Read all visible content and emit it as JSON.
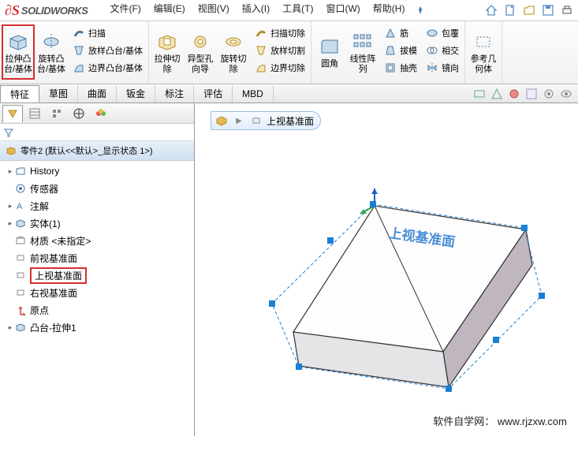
{
  "app": {
    "name": "SOLIDWORKS"
  },
  "menu": {
    "file": "文件(F)",
    "edit": "编辑(E)",
    "view": "视图(V)",
    "insert": "插入(I)",
    "tools": "工具(T)",
    "window": "窗口(W)",
    "help": "帮助(H)"
  },
  "ribbon": {
    "extrude_boss": "拉伸凸台/基体",
    "revolve_boss": "旋转凸台/基体",
    "swept": "扫描",
    "lofted": "放样凸台/基体",
    "boundary": "边界凸台/基体",
    "extrude_cut": "拉伸切除",
    "hole_wizard": "异型孔向导",
    "revolve_cut": "旋转切除",
    "swept_cut": "扫描切除",
    "lofted_cut": "放样切割",
    "boundary_cut": "边界切除",
    "fillet": "圆角",
    "linear_pattern": "线性阵列",
    "rib": "筋",
    "draft": "拔模",
    "shell": "抽壳",
    "wrap": "包覆",
    "intersect": "相交",
    "mirror": "镜向",
    "ref_geom": "参考几何体"
  },
  "tabs": {
    "features": "特征",
    "sketch": "草图",
    "surfaces": "曲面",
    "sheetmetal": "钣金",
    "annotate": "标注",
    "evaluate": "评估",
    "mbd": "MBD"
  },
  "tree": {
    "root": "零件2 (默认<<默认>_显示状态 1>)",
    "history": "History",
    "sensors": "传感器",
    "annotations": "注解",
    "bodies": "实体(1)",
    "material": "材质 <未指定>",
    "front_plane": "前视基准面",
    "top_plane": "上视基准面",
    "right_plane": "右视基准面",
    "origin": "原点",
    "extrude1": "凸台-拉伸1"
  },
  "breadcrumb": {
    "label": "上视基准面"
  },
  "viewport_label": "上视基准面",
  "watermark": {
    "site": "软件自学网：",
    "url": "www.rjzxw.com"
  }
}
